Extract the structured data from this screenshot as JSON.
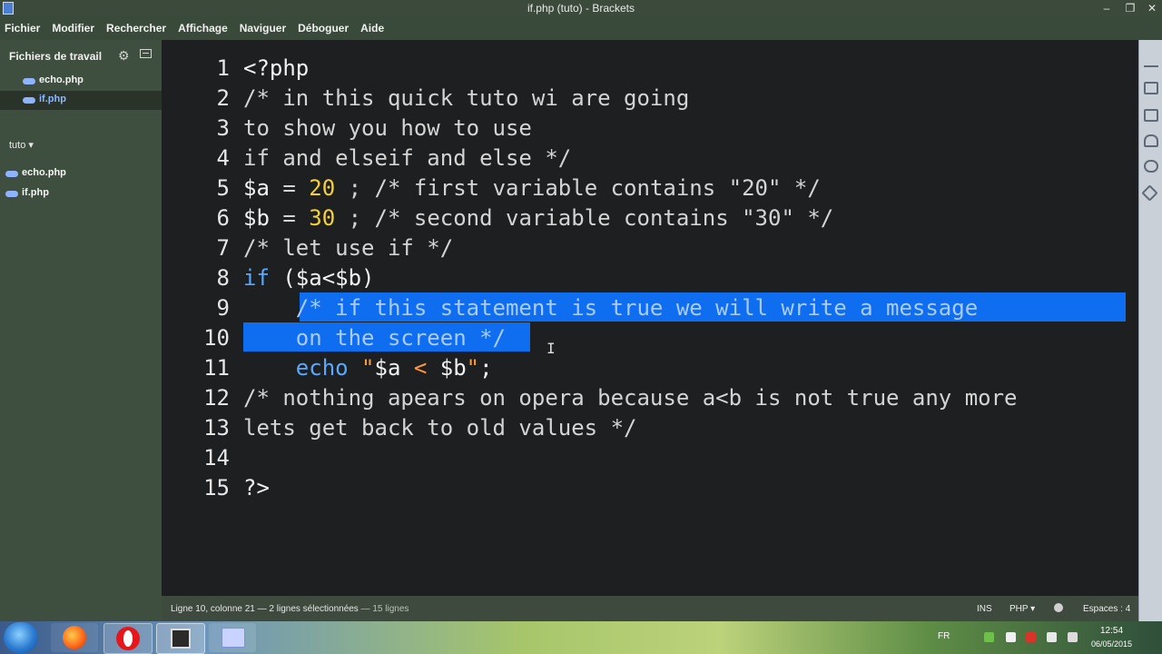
{
  "window": {
    "title": "if.php (tuto) - Brackets",
    "controls": {
      "minimize": "–",
      "restore": "❐",
      "close": "✕"
    }
  },
  "menu": [
    "Fichier",
    "Modifier",
    "Rechercher",
    "Affichage",
    "Naviguer",
    "Déboguer",
    "Aide"
  ],
  "sidebar": {
    "working_files_title": "Fichiers de travail",
    "working_files": [
      {
        "name": "echo.php",
        "selected": false
      },
      {
        "name": "if.php",
        "selected": true
      }
    ],
    "project_label": "tuto ▾",
    "project_files": [
      "echo.php",
      "if.php"
    ]
  },
  "editor": {
    "lines": [
      {
        "n": "1",
        "tokens": [
          {
            "t": "<?php",
            "c": "var"
          }
        ]
      },
      {
        "n": "2",
        "tokens": [
          {
            "t": "/* in this quick tuto wi are going",
            "c": ""
          }
        ]
      },
      {
        "n": "3",
        "tokens": [
          {
            "t": "to show you how to use",
            "c": ""
          }
        ]
      },
      {
        "n": "4",
        "tokens": [
          {
            "t": "if and elseif and else */",
            "c": ""
          }
        ]
      },
      {
        "n": "5",
        "tokens": [
          {
            "t": "$a",
            "c": "var"
          },
          {
            "t": " = ",
            "c": ""
          },
          {
            "t": "20",
            "c": "num"
          },
          {
            "t": " ; /* first variable contains \"20\" */",
            "c": ""
          }
        ]
      },
      {
        "n": "6",
        "tokens": [
          {
            "t": "$b",
            "c": "var"
          },
          {
            "t": " = ",
            "c": ""
          },
          {
            "t": "30",
            "c": "num"
          },
          {
            "t": " ; /* second variable contains \"30\" */",
            "c": ""
          }
        ]
      },
      {
        "n": "7",
        "tokens": [
          {
            "t": "/* let use if */",
            "c": ""
          }
        ]
      },
      {
        "n": "8",
        "tokens": [
          {
            "t": "if",
            "c": "kw"
          },
          {
            "t": " ($a<$b)",
            "c": "var"
          }
        ]
      },
      {
        "n": "9",
        "tokens": [
          {
            "t": "    ",
            "c": ""
          },
          {
            "t": "/* if this statement is true we will write a message",
            "c": "sel"
          }
        ]
      },
      {
        "n": "10",
        "tokens": [
          {
            "t": "    ",
            "c": ""
          },
          {
            "t": "on the screen */",
            "c": "sel"
          }
        ]
      },
      {
        "n": "11",
        "tokens": [
          {
            "t": "    ",
            "c": ""
          },
          {
            "t": "echo",
            "c": "kw"
          },
          {
            "t": " \"",
            "c": "str"
          },
          {
            "t": "$a",
            "c": "var"
          },
          {
            "t": " < ",
            "c": "str"
          },
          {
            "t": "$b",
            "c": "var"
          },
          {
            "t": "\"",
            "c": "str"
          },
          {
            "t": ";",
            "c": "var"
          }
        ]
      },
      {
        "n": "12",
        "tokens": [
          {
            "t": "/* nothing apears on opera because a<b is not true any more",
            "c": ""
          }
        ]
      },
      {
        "n": "13",
        "tokens": [
          {
            "t": "lets get back to old values */",
            "c": ""
          }
        ]
      },
      {
        "n": "14",
        "tokens": []
      },
      {
        "n": "15",
        "tokens": [
          {
            "t": "?>",
            "c": "var"
          }
        ]
      }
    ]
  },
  "status": {
    "position": "Ligne 10, colonne 21 — 2 lignes sélectionnées",
    "line_count": "— 15 lignes",
    "ins": "INS",
    "language": "PHP ▾",
    "spaces": "Espaces : 4"
  },
  "taskbar": {
    "language": "FR",
    "time": "12:54",
    "date": "06/05/2015"
  },
  "colors": {
    "keyword": "#5aa9ff",
    "number": "#f5d03a",
    "string": "#ff9a3c",
    "selection": "#0f6ef0",
    "editor_bg": "#1d1f21"
  }
}
